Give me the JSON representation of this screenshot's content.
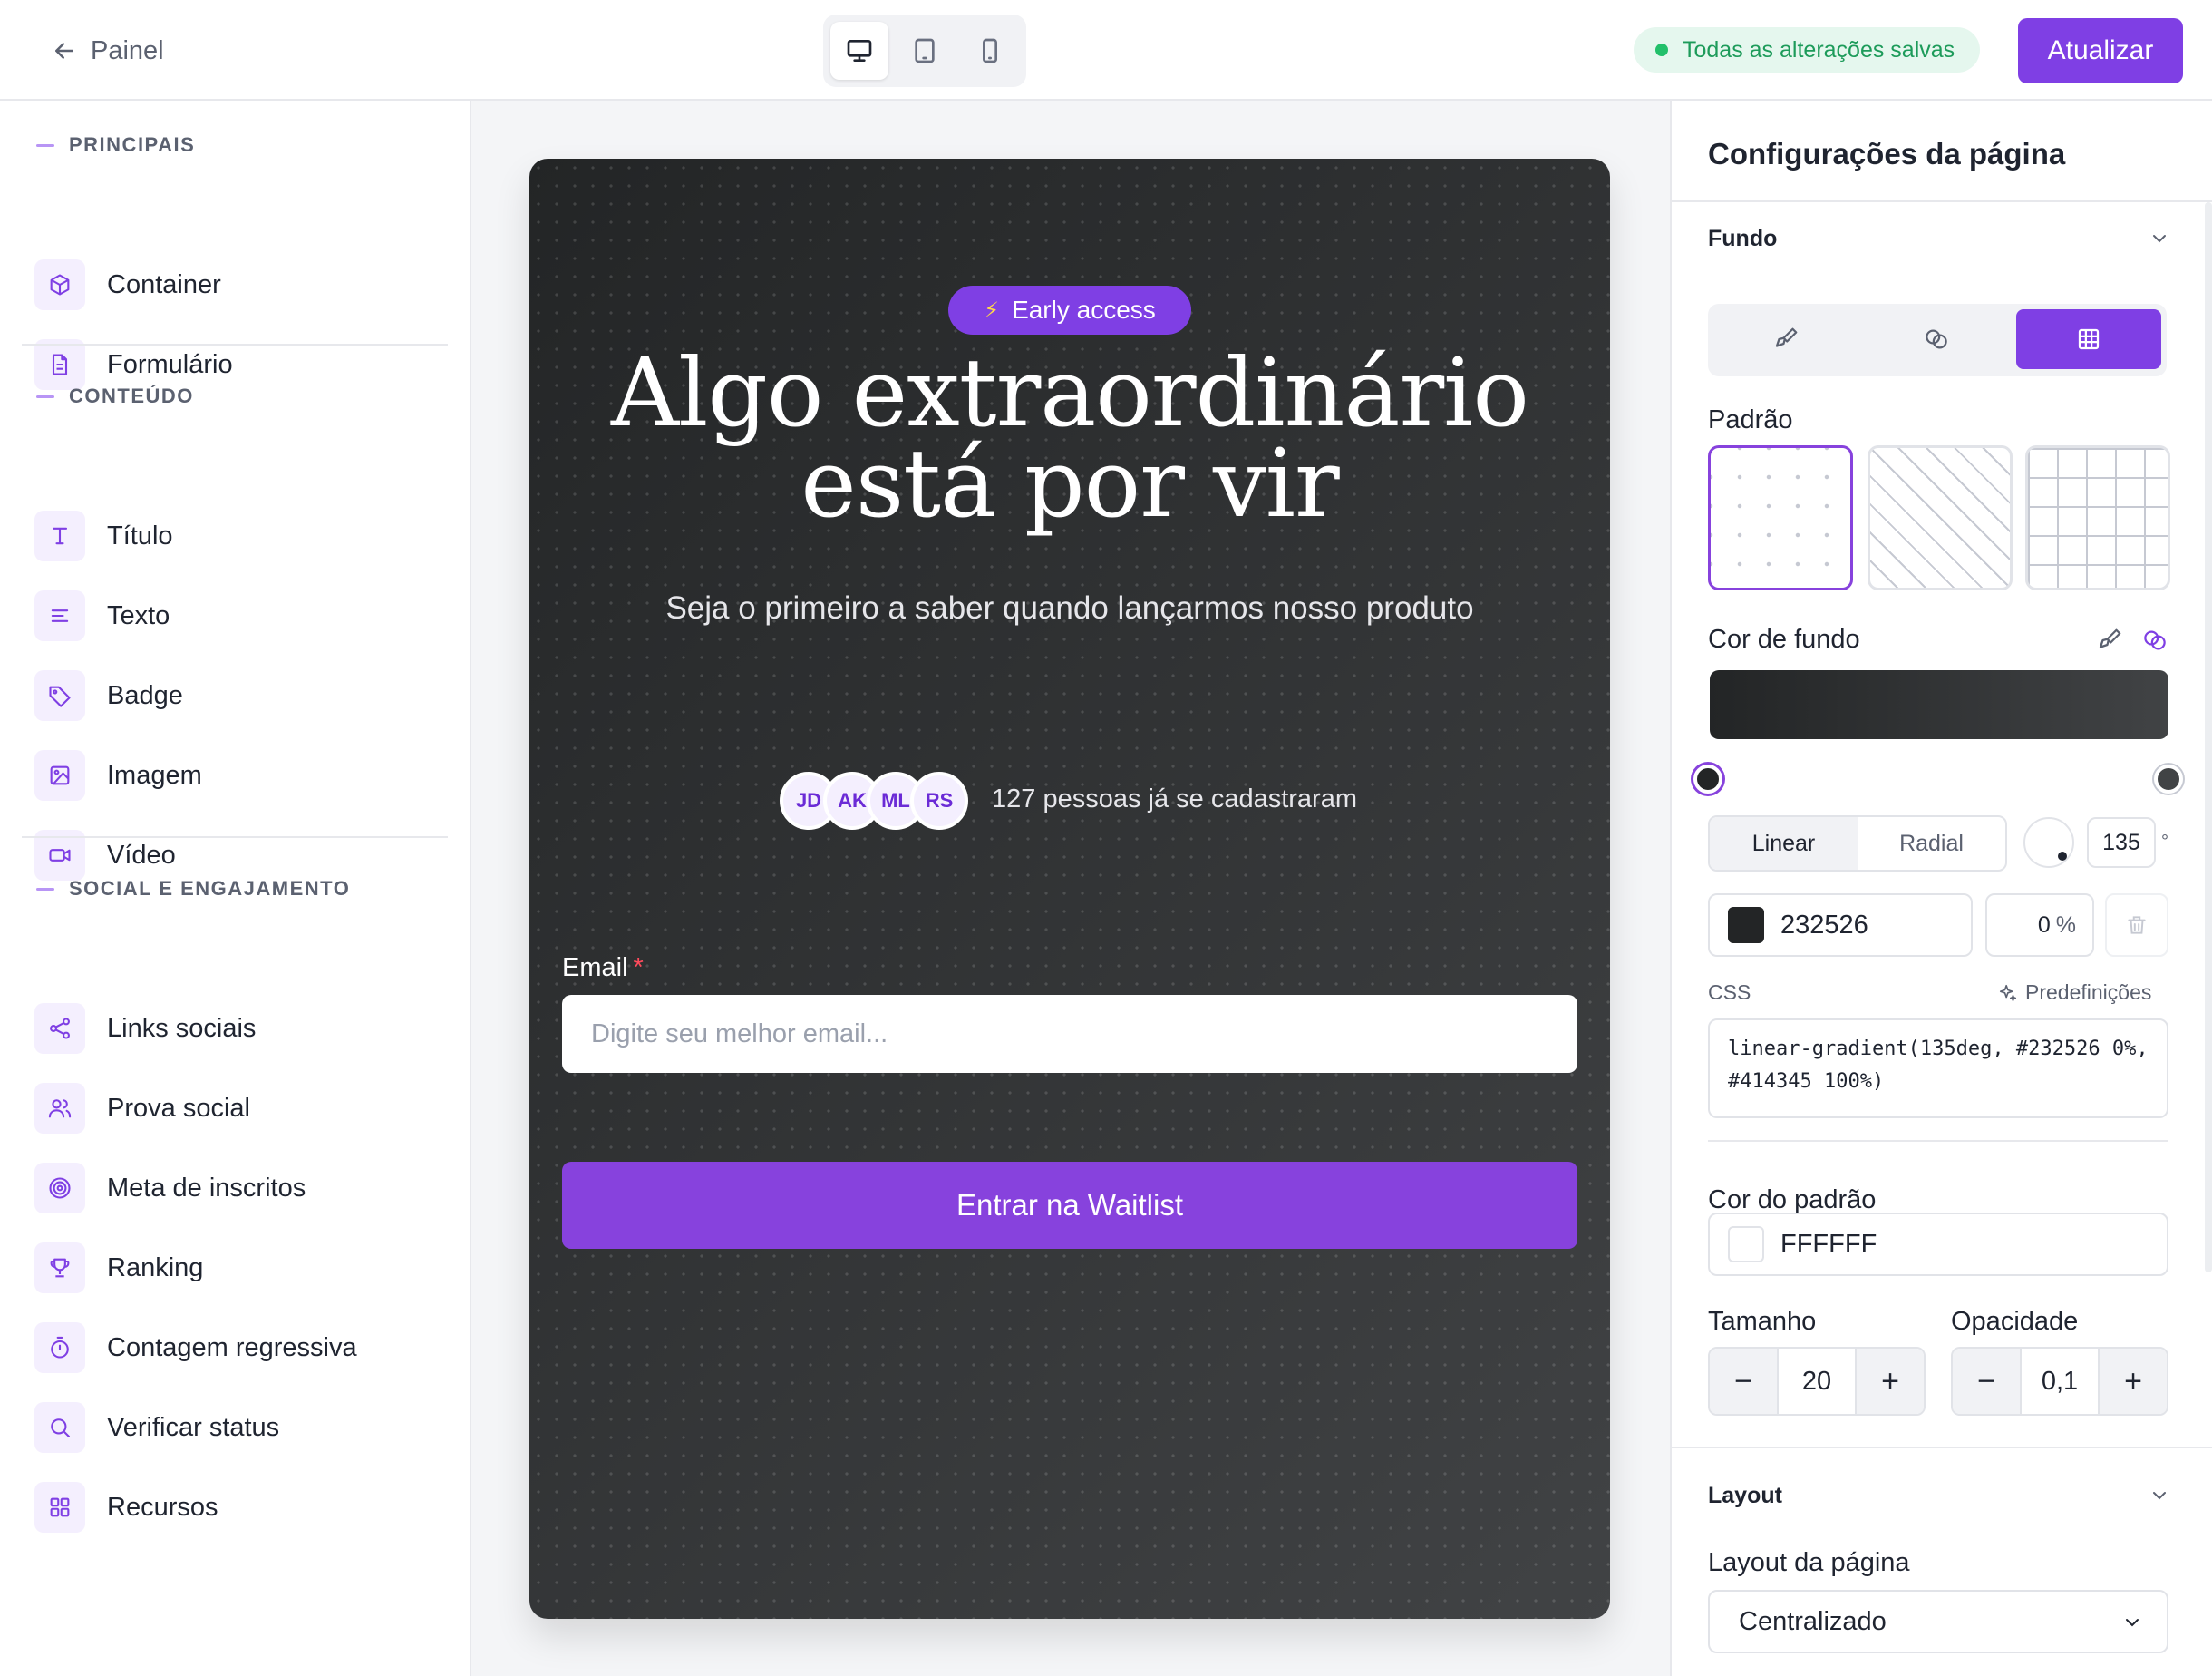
{
  "topbar": {
    "back_label": "Painel",
    "saved_status": "Todas as alterações salvas",
    "update_label": "Atualizar",
    "devices": [
      "desktop-icon",
      "tablet-icon",
      "mobile-icon"
    ]
  },
  "sidebar": {
    "sections": [
      {
        "title": "PRINCIPAIS",
        "items": [
          {
            "label": "Container",
            "icon": "box-icon"
          },
          {
            "label": "Formulário",
            "icon": "file-icon"
          }
        ]
      },
      {
        "title": "CONTEÚDO",
        "items": [
          {
            "label": "Título",
            "icon": "type-icon"
          },
          {
            "label": "Texto",
            "icon": "align-left-icon"
          },
          {
            "label": "Badge",
            "icon": "tag-icon"
          },
          {
            "label": "Imagem",
            "icon": "image-icon"
          },
          {
            "label": "Vídeo",
            "icon": "video-icon"
          }
        ]
      },
      {
        "title": "SOCIAL E ENGAJAMENTO",
        "items": [
          {
            "label": "Links sociais",
            "icon": "share-icon"
          },
          {
            "label": "Prova social",
            "icon": "users-icon"
          },
          {
            "label": "Meta de inscritos",
            "icon": "target-icon"
          },
          {
            "label": "Ranking",
            "icon": "trophy-icon"
          },
          {
            "label": "Contagem regressiva",
            "icon": "timer-icon"
          },
          {
            "label": "Verificar status",
            "icon": "search-icon"
          },
          {
            "label": "Recursos",
            "icon": "grid-icon"
          }
        ]
      }
    ]
  },
  "preview": {
    "badge": "Early access",
    "headline_line1": "Algo extraordinário",
    "headline_line2": "está por vir",
    "subtitle": "Seja o primeiro a saber quando lançarmos nosso produto",
    "avatars": [
      "JD",
      "AK",
      "ML",
      "RS"
    ],
    "social_proof": "127 pessoas já se cadastraram",
    "email_label": "Email",
    "required_mark": "*",
    "email_placeholder": "Digite seu melhor email...",
    "cta": "Entrar na Waitlist"
  },
  "panel": {
    "title": "Configurações da página",
    "background_section": "Fundo",
    "pattern_label": "Padrão",
    "bg_color_label": "Cor de fundo",
    "gradient_types": [
      "Linear",
      "Radial"
    ],
    "gradient_active": "Linear",
    "angle": "135",
    "angle_unit": "°",
    "stop_color": "232526",
    "stop_position": "0",
    "stop_unit": "%",
    "css_label": "CSS",
    "presets_label": "Predefinições",
    "css_value": "linear-gradient(135deg, #232526 0%, #414345 100%)",
    "pattern_color_label": "Cor do padrão",
    "pattern_color": "FFFFFF",
    "size_label": "Tamanho",
    "size_value": "20",
    "opacity_label": "Opacidade",
    "opacity_value": "0,1",
    "layout_section": "Layout",
    "page_layout_label": "Layout da página",
    "page_layout_value": "Centralizado"
  },
  "colors": {
    "accent": "#7f3fe4",
    "gradient_start": "#232526",
    "gradient_end": "#414345",
    "saved_green": "#1d9b5a"
  }
}
